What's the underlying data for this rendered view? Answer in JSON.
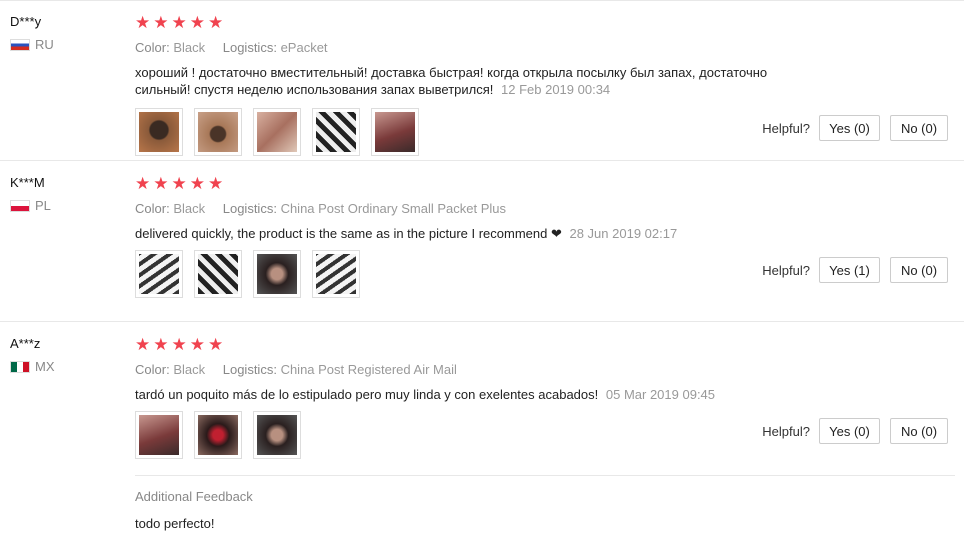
{
  "reviews": [
    {
      "user": "D***y",
      "country": "RU",
      "stars": "★★★★★",
      "color_label": "Color:",
      "color_value": "Black",
      "logistics_label": "Logistics:",
      "logistics_value": "ePacket",
      "text": "хороший ! достаточно вместительный! доставка быстрая! когда открыла посылку был запах, достаточно сильный! спустя неделю использования запах выветрился!",
      "date": "12 Feb 2019 00:34",
      "helpful_label": "Helpful?",
      "yes": "Yes (0)",
      "no": "No (0)"
    },
    {
      "user": "K***M",
      "country": "PL",
      "stars": "★★★★★",
      "color_label": "Color:",
      "color_value": "Black",
      "logistics_label": "Logistics:",
      "logistics_value": "China Post Ordinary Small Packet Plus",
      "text": "delivered quickly, the product is the same as in the picture I recommend ❤",
      "date": "28 Jun 2019 02:17",
      "helpful_label": "Helpful?",
      "yes": "Yes (1)",
      "no": "No (0)"
    },
    {
      "user": "A***z",
      "country": "MX",
      "stars": "★★★★★",
      "color_label": "Color:",
      "color_value": "Black",
      "logistics_label": "Logistics:",
      "logistics_value": "China Post Registered Air Mail",
      "text": "tardó un poquito más de lo estipulado pero muy linda y con exelentes acabados!",
      "date": "05 Mar 2019 09:45",
      "helpful_label": "Helpful?",
      "yes": "Yes (0)",
      "no": "No (0)",
      "additional_title": "Additional Feedback",
      "additional_text": "todo perfecto!"
    }
  ]
}
